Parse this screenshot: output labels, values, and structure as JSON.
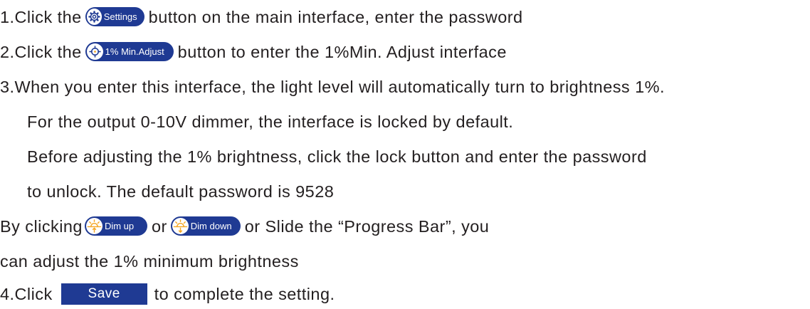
{
  "step1": {
    "prefix": "1.Click the",
    "button_label": "Settings",
    "button_icon": "gear-icon",
    "suffix": "button on the main interface, enter the password"
  },
  "step2": {
    "prefix": "2.Click the",
    "button_label": "1% Min.Adjust",
    "button_icon": "crosshair-icon",
    "suffix": "button to enter the 1%Min. Adjust interface"
  },
  "step3": {
    "line1": "3.When you enter this interface, the light level will automatically turn to brightness 1%.",
    "line2": "For the output 0-10V dimmer, the interface is locked by default.",
    "line3": "Before adjusting the 1% brightness, click the lock button and enter the password",
    "line4": "to unlock. The default password is 9528"
  },
  "dim": {
    "prefix": "By clicking",
    "dim_up_label": "Dim up",
    "dim_up_icon": "sun-up-icon",
    "or_text": "or",
    "dim_down_label": "Dim down",
    "dim_down_icon": "sun-down-icon",
    "suffix": "or Slide the “Progress Bar”, you",
    "line2": "can adjust the 1% minimum brightness"
  },
  "step4": {
    "prefix": "4.Click",
    "button_label": "Save",
    "suffix": "to complete the setting."
  },
  "colors": {
    "button_bg": "#1f3a93",
    "icon_accent": "#f5a623",
    "text": "#231f20"
  }
}
